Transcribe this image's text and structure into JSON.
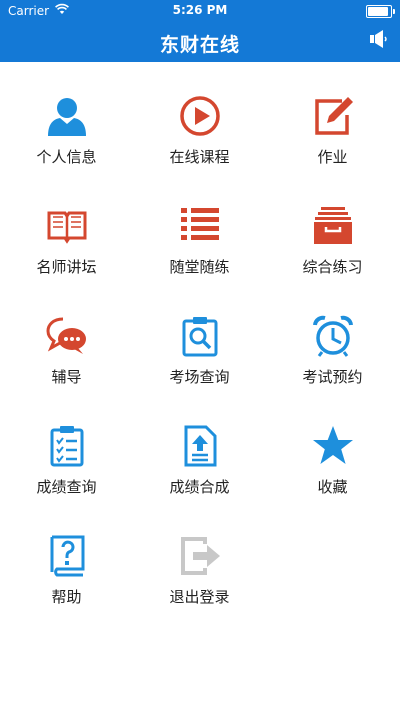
{
  "status_bar": {
    "carrier": "Carrier",
    "time": "5:26 PM"
  },
  "header": {
    "title": "东财在线",
    "speaker_icon": "speaker-icon"
  },
  "colors": {
    "header_bg": "#1479d6",
    "blue": "#1e8fdc",
    "red": "#d4472f",
    "gray": "#c8c8c8"
  },
  "menu": {
    "items": [
      {
        "label": "个人信息",
        "icon": "person-icon"
      },
      {
        "label": "在线课程",
        "icon": "play-circle-icon"
      },
      {
        "label": "作业",
        "icon": "edit-icon"
      },
      {
        "label": "名师讲坛",
        "icon": "book-icon"
      },
      {
        "label": "随堂随练",
        "icon": "list-icon"
      },
      {
        "label": "综合练习",
        "icon": "archive-icon"
      },
      {
        "label": "辅导",
        "icon": "chat-bubbles-icon"
      },
      {
        "label": "考场查询",
        "icon": "search-clipboard-icon"
      },
      {
        "label": "考试预约",
        "icon": "alarm-clock-icon"
      },
      {
        "label": "成绩查询",
        "icon": "checklist-clipboard-icon"
      },
      {
        "label": "成绩合成",
        "icon": "document-upload-icon"
      },
      {
        "label": "收藏",
        "icon": "star-icon"
      },
      {
        "label": "帮助",
        "icon": "help-book-icon"
      },
      {
        "label": "退出登录",
        "icon": "logout-icon"
      }
    ]
  }
}
